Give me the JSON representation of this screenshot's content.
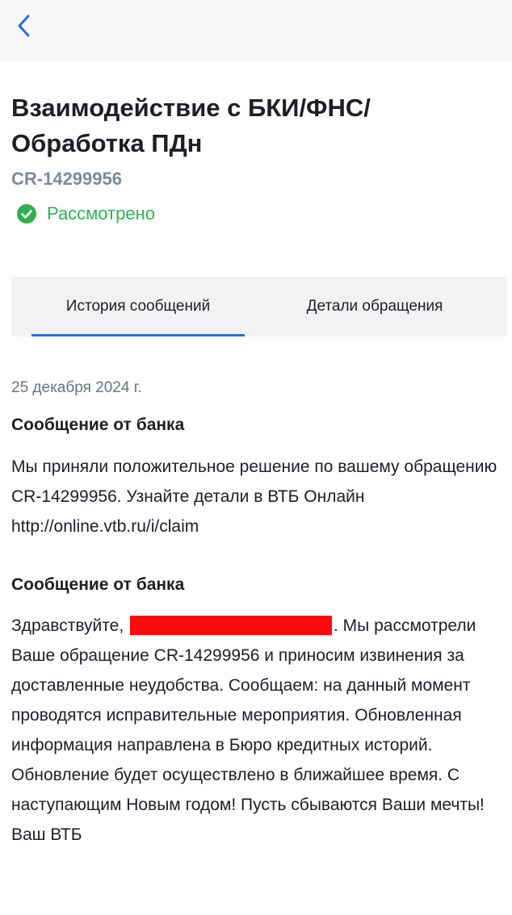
{
  "header": {
    "back_icon": "chevron-left-icon"
  },
  "request": {
    "title": "Взаимодействие с БКИ/ФНС/ Обработка ПДн",
    "id": "CR-14299956",
    "status_icon": "check-circle-icon",
    "status": "Рассмотрено",
    "status_color": "#2fb150"
  },
  "tabs": [
    {
      "label": "История сообщений",
      "active": true
    },
    {
      "label": "Детали обращения",
      "active": false
    }
  ],
  "accent_color": "#2870d9",
  "history": {
    "date": "25 декабря 2024 г.",
    "messages": [
      {
        "heading": "Сообщение от банка",
        "body": "Мы приняли положительное решение по вашему обращению CR-14299956. Узнайте детали в ВТБ Онлайн http://online.vtb.ru/i/claim"
      },
      {
        "heading": "Сообщение от банка",
        "greeting": "Здравствуйте,",
        "body": ". Мы рассмотрели Ваше обращение CR-14299956 и приносим извинения за доставленные неудобства. Сообщаем: на данный момент проводятся исправительные мероприятия. Обновленная информация направлена в Бюро кредитных историй. Обновление будет осуществлено в ближайшее время. С наступающим Новым годом! Пусть сбываются Ваши мечты!   Ваш ВТБ"
      }
    ]
  }
}
